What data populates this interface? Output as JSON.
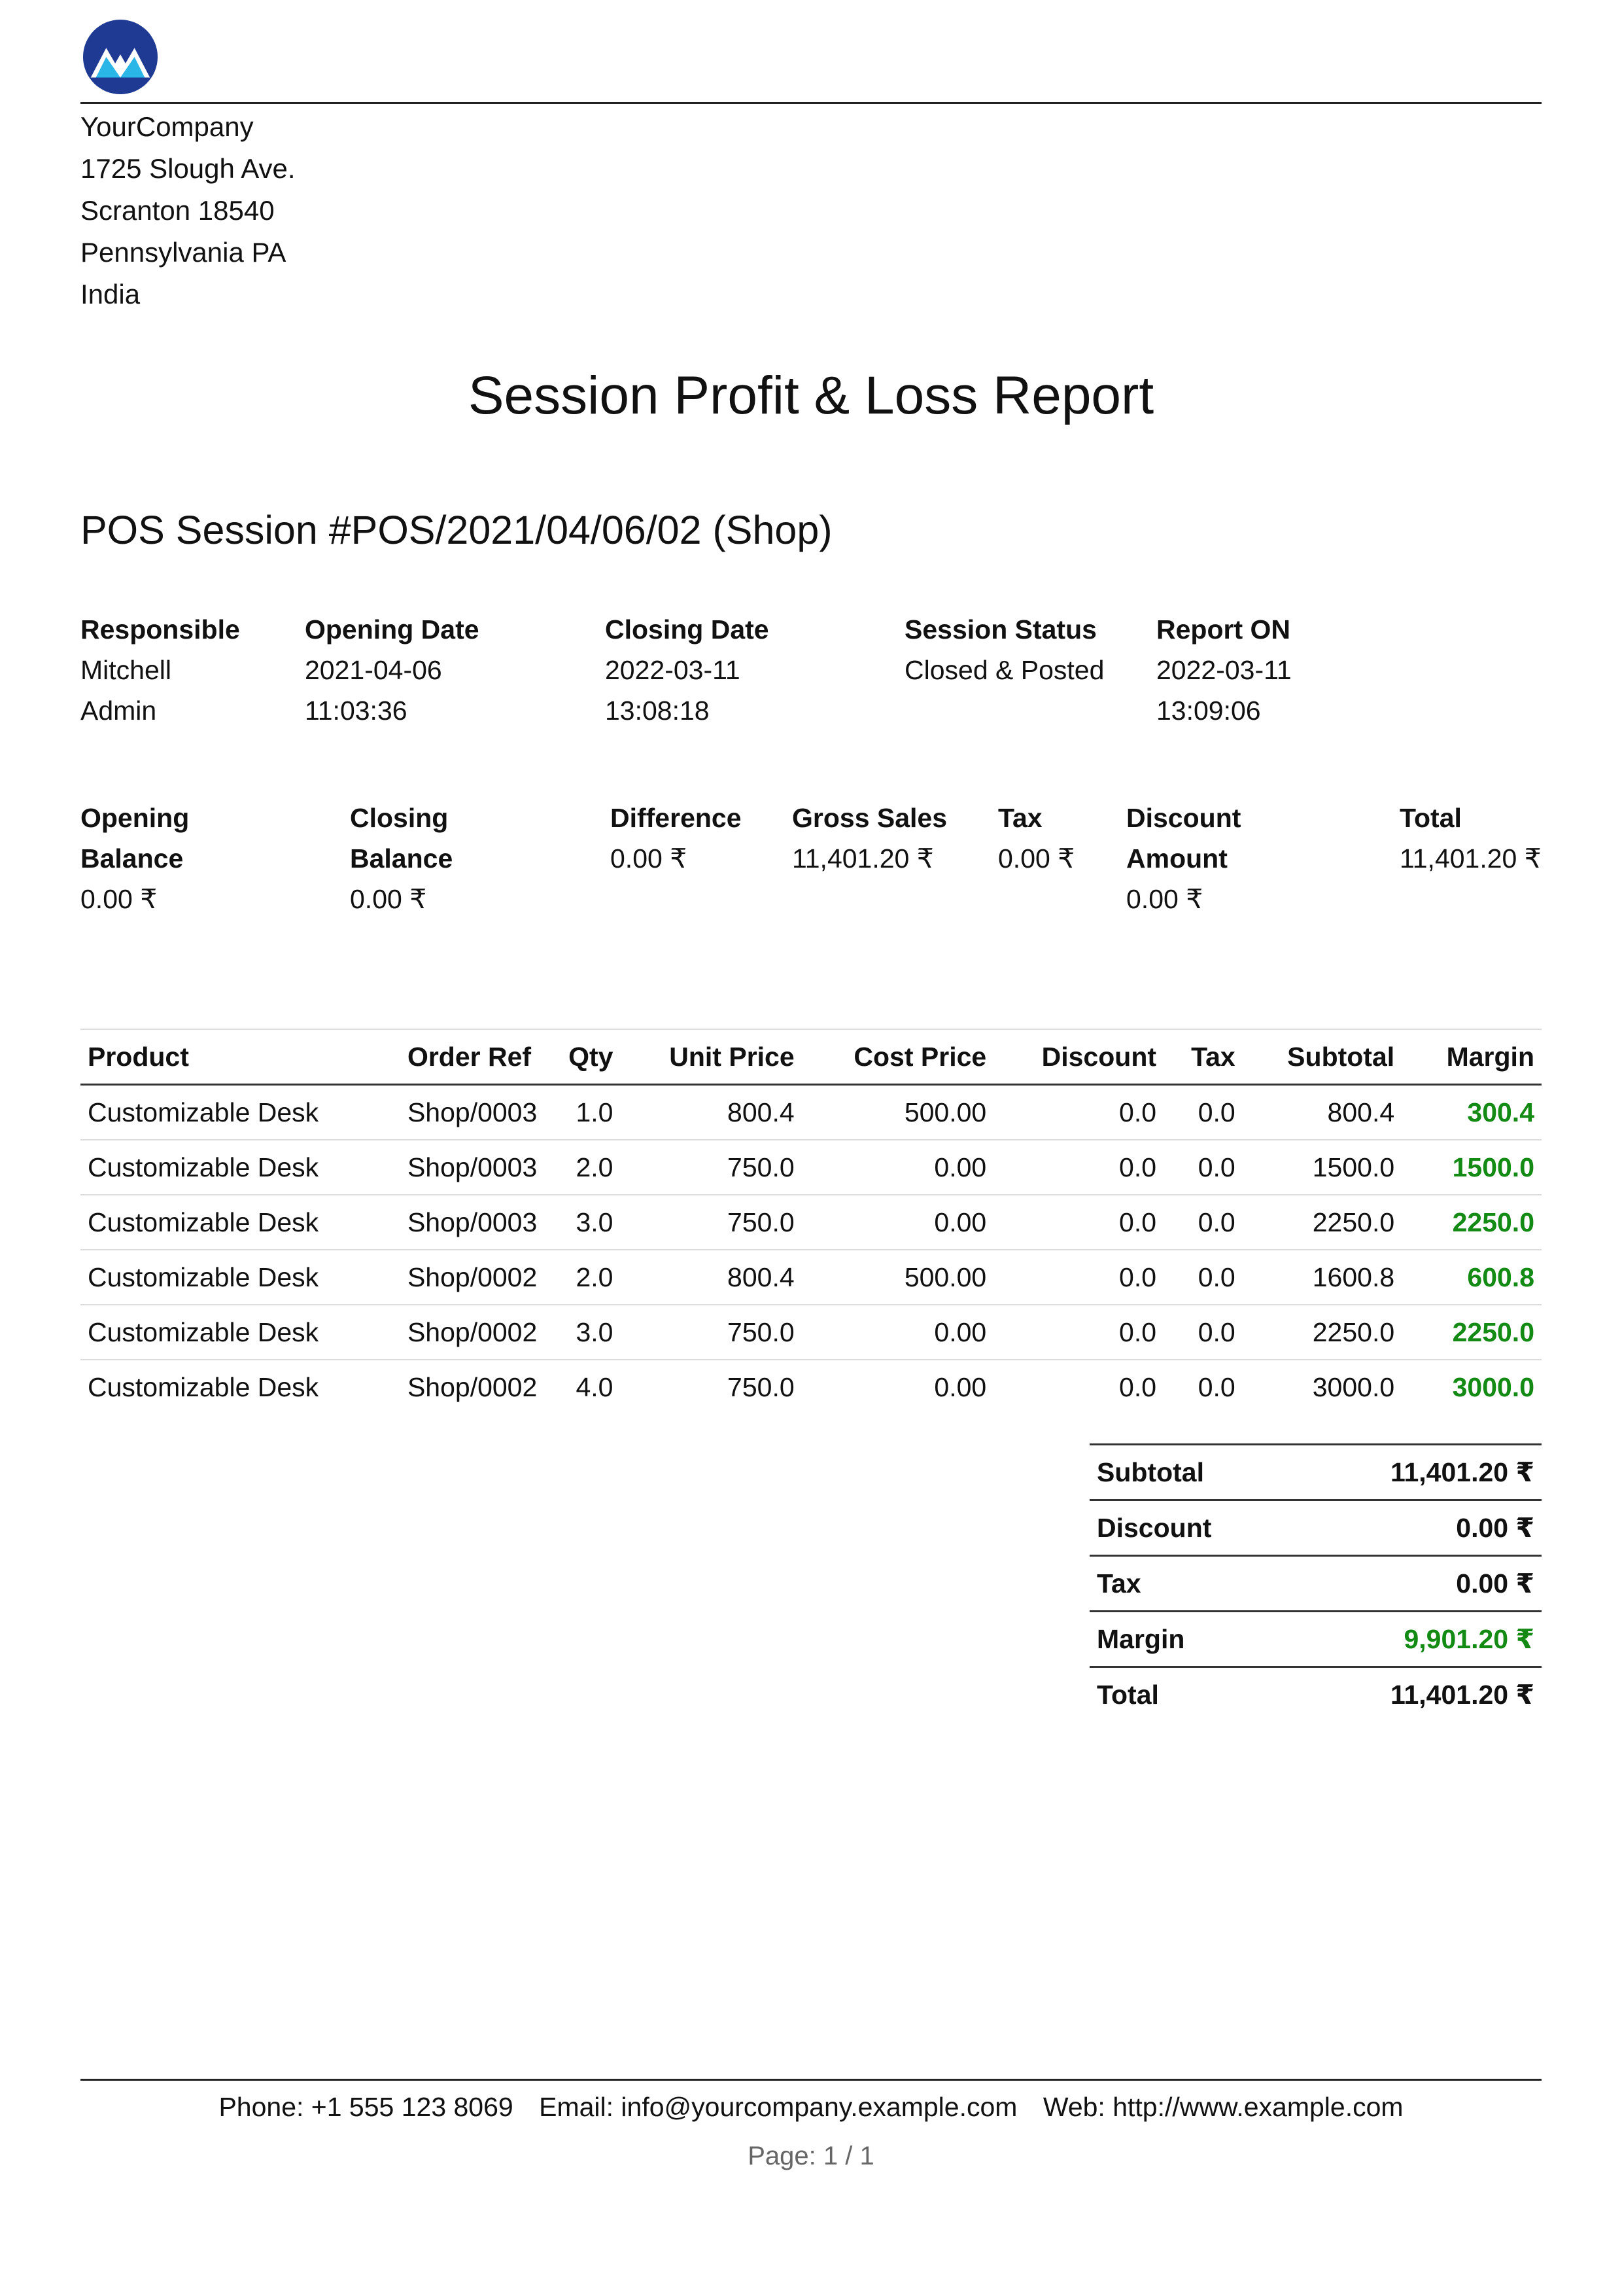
{
  "company": {
    "name": "YourCompany",
    "address": [
      "1725 Slough Ave.",
      "Scranton 18540",
      "Pennsylvania PA",
      "India"
    ],
    "logo_icon": "mountain-logo-icon",
    "logo_color": "#1f3a93",
    "logo_accent": "#2bb6e8"
  },
  "report_title": "Session Profit & Loss Report",
  "session_title": "POS Session #POS/2021/04/06/02 (Shop)",
  "session_info": {
    "responsible": {
      "label": "Responsible",
      "lines": [
        "Mitchell",
        "Admin"
      ]
    },
    "opening_date": {
      "label": "Opening Date",
      "lines": [
        "2021-04-06",
        "11:03:36"
      ]
    },
    "closing_date": {
      "label": "Closing Date",
      "lines": [
        "2022-03-11",
        "13:08:18"
      ]
    },
    "session_status": {
      "label": "Session Status",
      "lines": [
        "Closed & Posted"
      ]
    },
    "report_on": {
      "label": "Report ON",
      "lines": [
        "2022-03-11",
        "13:09:06"
      ]
    }
  },
  "balances": {
    "opening_balance": {
      "label_lines": [
        "Opening",
        "Balance"
      ],
      "value": "0.00 ₹"
    },
    "closing_balance": {
      "label_lines": [
        "Closing",
        "Balance"
      ],
      "value": "0.00 ₹"
    },
    "difference": {
      "label": "Difference",
      "value": "0.00 ₹"
    },
    "gross_sales": {
      "label": "Gross Sales",
      "value": "11,401.20 ₹"
    },
    "tax": {
      "label": "Tax",
      "value": "0.00 ₹"
    },
    "discount_amount": {
      "label_lines": [
        "Discount",
        "Amount"
      ],
      "value": "0.00 ₹"
    },
    "total": {
      "label": "Total",
      "value": "11,401.20 ₹"
    }
  },
  "lines_table": {
    "headers": [
      "Product",
      "Order Ref",
      "Qty",
      "Unit Price",
      "Cost Price",
      "Discount",
      "Tax",
      "Subtotal",
      "Margin"
    ],
    "rows": [
      [
        "Customizable Desk",
        "Shop/0003",
        "1.0",
        "800.4",
        "500.00",
        "0.0",
        "0.0",
        "800.4",
        "300.4"
      ],
      [
        "Customizable Desk",
        "Shop/0003",
        "2.0",
        "750.0",
        "0.00",
        "0.0",
        "0.0",
        "1500.0",
        "1500.0"
      ],
      [
        "Customizable Desk",
        "Shop/0003",
        "3.0",
        "750.0",
        "0.00",
        "0.0",
        "0.0",
        "2250.0",
        "2250.0"
      ],
      [
        "Customizable Desk",
        "Shop/0002",
        "2.0",
        "800.4",
        "500.00",
        "0.0",
        "0.0",
        "1600.8",
        "600.8"
      ],
      [
        "Customizable Desk",
        "Shop/0002",
        "3.0",
        "750.0",
        "0.00",
        "0.0",
        "0.0",
        "2250.0",
        "2250.0"
      ],
      [
        "Customizable Desk",
        "Shop/0002",
        "4.0",
        "750.0",
        "0.00",
        "0.0",
        "0.0",
        "3000.0",
        "3000.0"
      ]
    ]
  },
  "totals": {
    "subtotal": {
      "label": "Subtotal",
      "value": "11,401.20 ₹"
    },
    "discount": {
      "label": "Discount",
      "value": "0.00 ₹"
    },
    "tax": {
      "label": "Tax",
      "value": "0.00 ₹"
    },
    "margin": {
      "label": "Margin",
      "value": "9,901.20 ₹"
    },
    "total": {
      "label": "Total",
      "value": "11,401.20 ₹"
    }
  },
  "footer": {
    "phone": "Phone: +1 555 123 8069",
    "email": "Email: info@yourcompany.example.com",
    "web": "Web: http://www.example.com",
    "page": "Page: 1 / 1"
  },
  "colors": {
    "margin_green": "#138a13",
    "footer_gray": "#666666"
  }
}
